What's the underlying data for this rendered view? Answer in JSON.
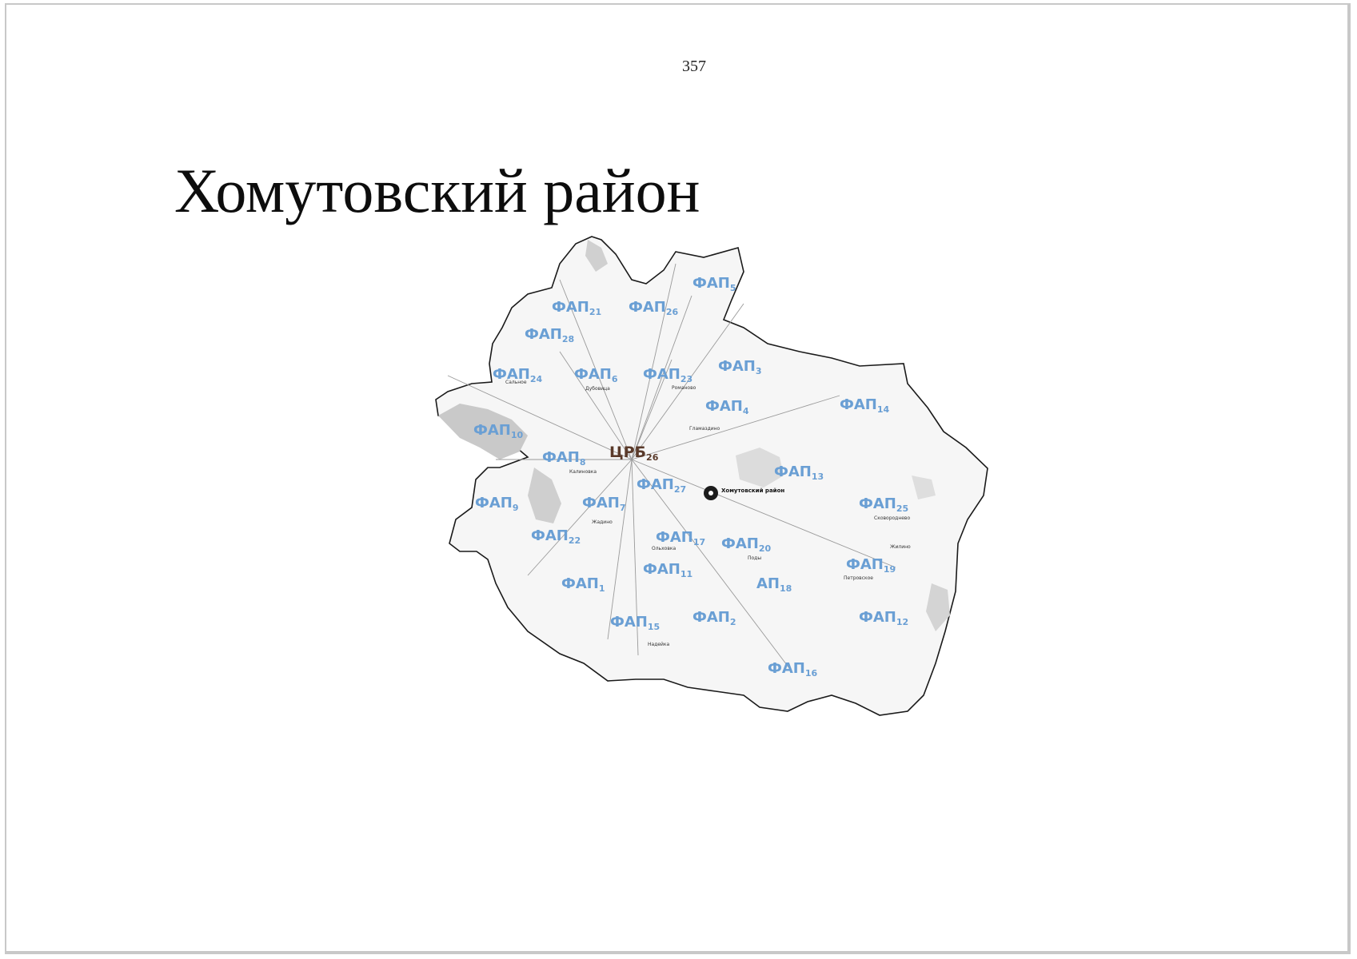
{
  "page": {
    "number": "357",
    "title": "Хомутовский район"
  },
  "map": {
    "district_center_label": "Хомутовский район",
    "crb": {
      "text": "ЦРБ",
      "sub": "26"
    },
    "faps": [
      {
        "text": "ФАП",
        "sub": "5"
      },
      {
        "text": "ФАП",
        "sub": "21"
      },
      {
        "text": "ФАП",
        "sub": "26"
      },
      {
        "text": "ФАП",
        "sub": "28"
      },
      {
        "text": "ФАП",
        "sub": "24"
      },
      {
        "text": "ФАП",
        "sub": "6"
      },
      {
        "text": "ФАП",
        "sub": "23"
      },
      {
        "text": "ФАП",
        "sub": "3"
      },
      {
        "text": "ФАП",
        "sub": "4"
      },
      {
        "text": "ФАП",
        "sub": "14"
      },
      {
        "text": "ФАП",
        "sub": "10"
      },
      {
        "text": "ФАП",
        "sub": "8"
      },
      {
        "text": "ФАП",
        "sub": "13"
      },
      {
        "text": "ФАП",
        "sub": "9"
      },
      {
        "text": "ФАП",
        "sub": "7"
      },
      {
        "text": "ФАП",
        "sub": "27"
      },
      {
        "text": "ФАП",
        "sub": "25"
      },
      {
        "text": "ФАП",
        "sub": "22"
      },
      {
        "text": "ФАП",
        "sub": "17"
      },
      {
        "text": "ФАП",
        "sub": "20"
      },
      {
        "text": "ФАП",
        "sub": "19"
      },
      {
        "text": "ФАП",
        "sub": "11"
      },
      {
        "text": "ФАП",
        "sub": "1"
      },
      {
        "text": "АП",
        "sub": "18"
      },
      {
        "text": "ФАП",
        "sub": "15"
      },
      {
        "text": "ФАП",
        "sub": "2"
      },
      {
        "text": "ФАП",
        "sub": "12"
      },
      {
        "text": "ФАП",
        "sub": "16"
      }
    ],
    "villages": [
      "Дубовица",
      "Романово",
      "Калиновка",
      "Поды",
      "Ольховка",
      "Надейка",
      "Сковороднево",
      "Жилино",
      "Гламаздино",
      "Петровское",
      "Сальное",
      "Жадино"
    ],
    "colors": {
      "fap": "#6a9fd4",
      "crb": "#5a3a2a",
      "border": "#1a1a1a",
      "water": "#c9c9c9"
    }
  }
}
